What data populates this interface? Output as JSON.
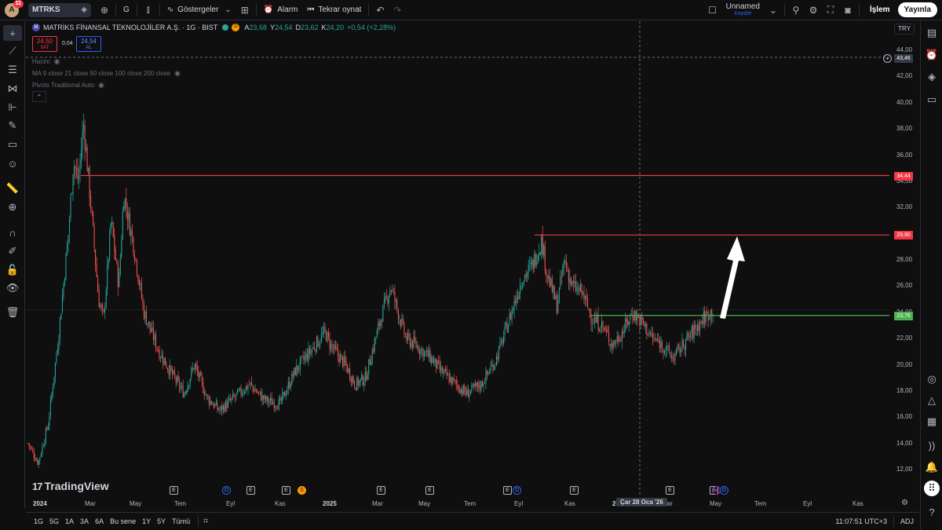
{
  "topbar": {
    "avatar_letter": "A",
    "notif_count": "11",
    "symbol": "MTRKS",
    "interval": "G",
    "indicators_label": "Göstergeler",
    "alarm_label": "Alarm",
    "replay_label": "Tekrar oynat",
    "layout_name": "Unnamed",
    "layout_status": "Kaydet",
    "trade_label": "İşlem",
    "publish_label": "Yayınla"
  },
  "legend": {
    "logo_letter": "M",
    "title": "MATRİKS FİNANSAL TEKNOLOJİLER A.Ş. · 1G · BIST",
    "d_badge": "D",
    "ohlc": [
      {
        "k": "A",
        "v": "23,68"
      },
      {
        "k": "Y",
        "v": "24,54"
      },
      {
        "k": "D",
        "v": "23,62"
      },
      {
        "k": "K",
        "v": "24,20"
      },
      {
        "k": "",
        "v": "+0,54 (+2,28%)"
      }
    ],
    "sell_price": "24,50",
    "sell_label": "SAT",
    "spread": "0,04",
    "buy_price": "24,54",
    "buy_label": "AL",
    "indicator_1": "Hacim",
    "indicator_2": "MA 9 close 21 close 50 close 100 close 200 close",
    "indicator_3": "Pivots Traditional Auto",
    "brand": "TradingView",
    "currency": "TRY"
  },
  "colors": {
    "up": "#26a69a",
    "down": "#ef5350",
    "resistance": "#f23645",
    "support": "#4caf50",
    "background": "#0f0f0f"
  },
  "price_tags": {
    "crosshair": "43,46",
    "r1": "34,44",
    "r2": "29,90",
    "s1": "23,76"
  },
  "chart_data": {
    "type": "candlestick",
    "title": "MATRİKS FİNANSAL TEKNOLOJİLER A.Ş. · 1G · BIST",
    "ylim": [
      11,
      45
    ],
    "y_ticks": [
      12,
      14,
      16,
      18,
      20,
      22,
      24,
      26,
      28,
      30,
      32,
      34,
      36,
      38,
      40,
      42,
      44
    ],
    "y_tick_labels": [
      "12,00",
      "14,00",
      "16,00",
      "18,00",
      "20,00",
      "22,00",
      "24,00",
      "26,00",
      "28,00",
      "30,00",
      "32,00",
      "34,00",
      "36,00",
      "38,00",
      "40,00",
      "42,00",
      "44,00"
    ],
    "x_labels": [
      "2024",
      "Mar",
      "May",
      "Tem",
      "Eyl",
      "Kas",
      "2025",
      "Mar",
      "May",
      "Tem",
      "Eyl",
      "Kas",
      "2026",
      "Mar",
      "May",
      "Tem",
      "Eyl",
      "Kas"
    ],
    "crosshair_date": "Çar 28 Oca '26",
    "horizontal_lines": [
      {
        "value": 34.44,
        "color": "#f23645"
      },
      {
        "value": 29.9,
        "color": "#f23645"
      },
      {
        "value": 23.76,
        "color": "#4caf50"
      }
    ],
    "last_price": 24.2,
    "price_path": [
      [
        0,
        14.0
      ],
      [
        0.02,
        12.5
      ],
      [
        0.04,
        15.5
      ],
      [
        0.06,
        22.0
      ],
      [
        0.08,
        30.0
      ],
      [
        0.09,
        35.5
      ],
      [
        0.1,
        34.0
      ],
      [
        0.11,
        38.5
      ],
      [
        0.125,
        32.0
      ],
      [
        0.14,
        25.0
      ],
      [
        0.15,
        23.5
      ],
      [
        0.165,
        31.0
      ],
      [
        0.18,
        26.0
      ],
      [
        0.19,
        33.0
      ],
      [
        0.21,
        29.0
      ],
      [
        0.23,
        24.0
      ],
      [
        0.26,
        21.0
      ],
      [
        0.29,
        19.0
      ],
      [
        0.31,
        17.8
      ],
      [
        0.33,
        20.0
      ],
      [
        0.355,
        17.5
      ],
      [
        0.38,
        16.5
      ],
      [
        0.41,
        17.5
      ],
      [
        0.44,
        18.5
      ],
      [
        0.47,
        17.3
      ],
      [
        0.5,
        17.0
      ],
      [
        0.53,
        19.5
      ],
      [
        0.56,
        21.0
      ],
      [
        0.59,
        22.5
      ],
      [
        0.6,
        21.5
      ],
      [
        0.63,
        20.0
      ],
      [
        0.65,
        18.5
      ],
      [
        0.67,
        19.0
      ],
      [
        0.7,
        23.5
      ],
      [
        0.72,
        26.0
      ],
      [
        0.735,
        24.0
      ],
      [
        0.75,
        22.0
      ],
      [
        0.77,
        21.5
      ],
      [
        0.8,
        20.5
      ],
      [
        0.82,
        19.5
      ],
      [
        0.85,
        18.5
      ],
      [
        0.87,
        17.8
      ],
      [
        0.9,
        18.5
      ],
      [
        0.93,
        20.5
      ],
      [
        0.96,
        24.0
      ],
      [
        0.98,
        26.5
      ],
      [
        1.0,
        27.5
      ],
      [
        1.02,
        29.5
      ],
      [
        1.03,
        27.0
      ],
      [
        1.05,
        24.5
      ],
      [
        1.065,
        28.0
      ],
      [
        1.08,
        26.0
      ],
      [
        1.1,
        25.5
      ],
      [
        1.12,
        23.5
      ],
      [
        1.14,
        23.0
      ],
      [
        1.16,
        21.5
      ],
      [
        1.18,
        22.5
      ],
      [
        1.2,
        24.0
      ],
      [
        1.22,
        23.2
      ],
      [
        1.24,
        22.0
      ],
      [
        1.26,
        21.5
      ],
      [
        1.28,
        20.5
      ],
      [
        1.3,
        21.5
      ],
      [
        1.32,
        22.5
      ],
      [
        1.34,
        23.5
      ],
      [
        1.36,
        24.2
      ]
    ]
  },
  "events": [
    {
      "type": "e",
      "label": "E"
    },
    {
      "type": "d",
      "label": "D"
    },
    {
      "type": "e",
      "label": "E"
    },
    {
      "type": "e",
      "label": "E"
    },
    {
      "type": "s",
      "label": "S"
    },
    {
      "type": "e",
      "label": "E"
    },
    {
      "type": "e",
      "label": "E"
    },
    {
      "type": "e",
      "label": "E"
    },
    {
      "type": "d",
      "label": "D"
    },
    {
      "type": "e",
      "label": "E"
    },
    {
      "type": "e",
      "label": "E"
    },
    {
      "type": "e",
      "label": "E"
    },
    {
      "type": "p",
      "label": "⚡"
    },
    {
      "type": "d",
      "label": "D"
    }
  ],
  "bottombar": {
    "ranges": [
      "1G",
      "5G",
      "1A",
      "3A",
      "6A",
      "Bu sene",
      "1Y",
      "5Y",
      "Tümü"
    ],
    "time": "11:07:51 UTC+3",
    "adj": "ADJ"
  }
}
